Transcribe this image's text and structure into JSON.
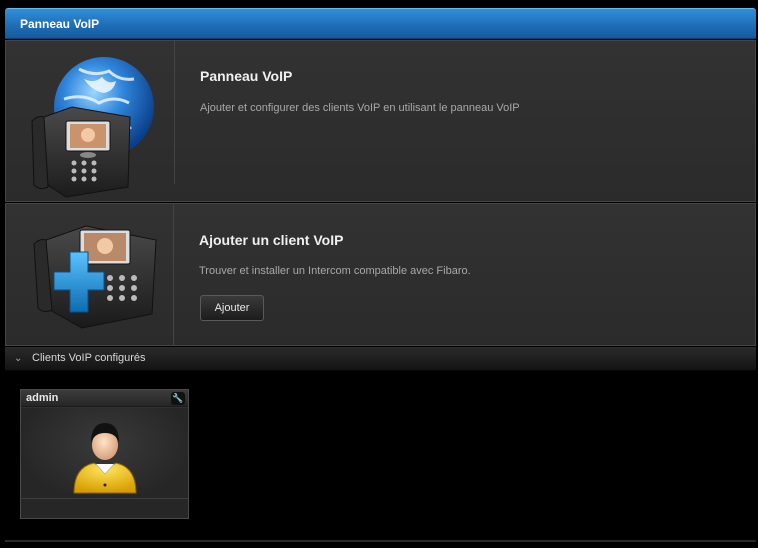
{
  "window": {
    "title": "Panneau VoIP"
  },
  "intro": {
    "title": "Panneau VoIP",
    "description": "Ajouter et configurer des clients VoIP en utilisant le panneau VoIP"
  },
  "add_client": {
    "title": "Ajouter un client VoIP",
    "description": "Trouver et installer un Intercom compatible avec Fibaro.",
    "button_label": "Ajouter"
  },
  "clients_section": {
    "label": "Clients VoIP configurés",
    "clients": [
      {
        "name": "admin"
      }
    ]
  },
  "colors": {
    "accent": "#1f6fb8",
    "plus": "#1e95d8",
    "avatar_shirt": "#f3c81a"
  },
  "icons": [
    "globe-phone-icon",
    "phone-plus-icon",
    "chevron-down-icon",
    "wrench-icon",
    "user-avatar-icon"
  ]
}
